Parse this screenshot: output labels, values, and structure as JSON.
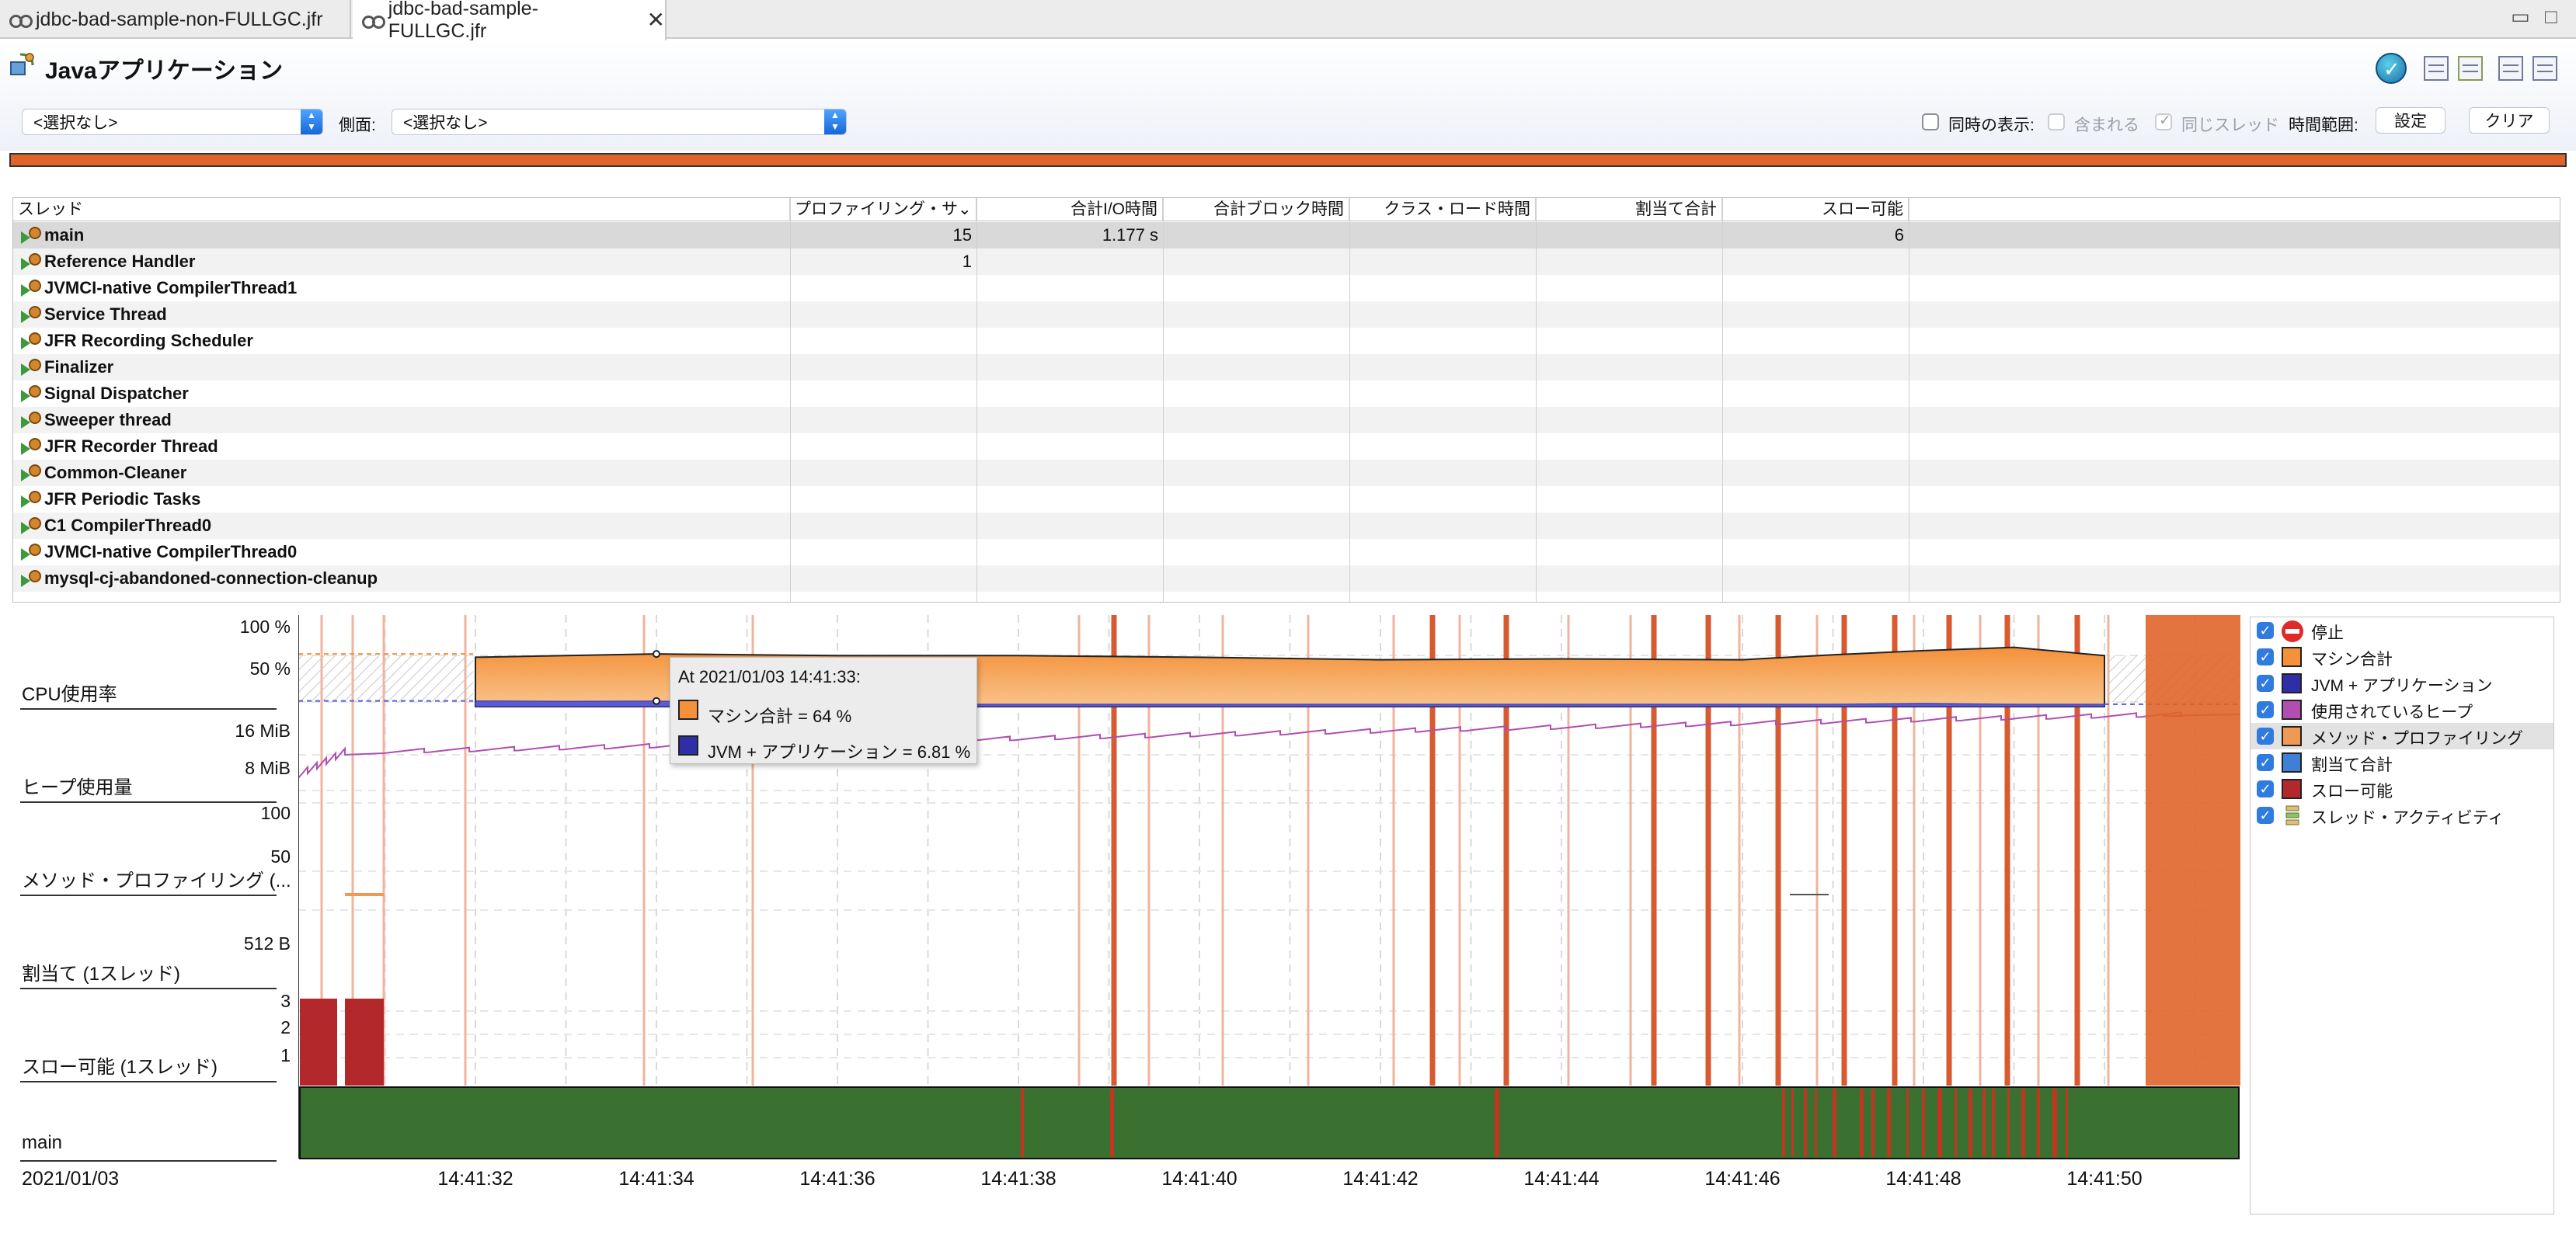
{
  "tabs": [
    {
      "label": "jdbc-bad-sample-non-FULLGC.jfr",
      "active": false
    },
    {
      "label": "jdbc-bad-sample-FULLGC.jfr",
      "active": true
    }
  ],
  "window": {
    "minimize": "▭",
    "maximize": "□"
  },
  "page": {
    "title": "Javaアプリケーション",
    "status_icon": "check-icon"
  },
  "filter": {
    "primary_value": "<選択なし>",
    "aspect_label": "側面:",
    "aspect_value": "<選択なし>",
    "concurrent_label": "同時の表示:",
    "include_label": "含まれる",
    "same_thread_label": "同じスレッド",
    "time_range_label": "時間範囲:",
    "set_button": "設定",
    "clear_button": "クリア"
  },
  "colors": {
    "range_bar": "#e0642a",
    "machine_total": "#f4913a",
    "jvm_app": "#2e2ea6",
    "heap": "#b04fb0",
    "method_profiling": "#ee9a55",
    "allocation": "#3f7fd6",
    "throwables": "#b3282b",
    "thread_running": "#3a7030",
    "thread_blocked": "#c43521"
  },
  "table": {
    "columns": [
      "スレッド",
      "プロファイリング・サ",
      "合計I/O時間",
      "合計ブロック時間",
      "クラス・ロード時間",
      "割当て合計",
      "スロー可能"
    ],
    "sort_indicator": "⌄",
    "rows": [
      {
        "name": "main",
        "profiling": "15",
        "io": "1.177 s",
        "block": "",
        "classload": "",
        "alloc": "",
        "throwables": "6"
      },
      {
        "name": "Reference Handler",
        "profiling": "1",
        "io": "",
        "block": "",
        "classload": "",
        "alloc": "",
        "throwables": ""
      },
      {
        "name": "JVMCI-native CompilerThread1",
        "profiling": "",
        "io": "",
        "block": "",
        "classload": "",
        "alloc": "",
        "throwables": ""
      },
      {
        "name": "Service Thread",
        "profiling": "",
        "io": "",
        "block": "",
        "classload": "",
        "alloc": "",
        "throwables": ""
      },
      {
        "name": "JFR Recording Scheduler",
        "profiling": "",
        "io": "",
        "block": "",
        "classload": "",
        "alloc": "",
        "throwables": ""
      },
      {
        "name": "Finalizer",
        "profiling": "",
        "io": "",
        "block": "",
        "classload": "",
        "alloc": "",
        "throwables": ""
      },
      {
        "name": "Signal Dispatcher",
        "profiling": "",
        "io": "",
        "block": "",
        "classload": "",
        "alloc": "",
        "throwables": ""
      },
      {
        "name": "Sweeper thread",
        "profiling": "",
        "io": "",
        "block": "",
        "classload": "",
        "alloc": "",
        "throwables": ""
      },
      {
        "name": "JFR Recorder Thread",
        "profiling": "",
        "io": "",
        "block": "",
        "classload": "",
        "alloc": "",
        "throwables": ""
      },
      {
        "name": "Common-Cleaner",
        "profiling": "",
        "io": "",
        "block": "",
        "classload": "",
        "alloc": "",
        "throwables": ""
      },
      {
        "name": "JFR Periodic Tasks",
        "profiling": "",
        "io": "",
        "block": "",
        "classload": "",
        "alloc": "",
        "throwables": ""
      },
      {
        "name": "C1 CompilerThread0",
        "profiling": "",
        "io": "",
        "block": "",
        "classload": "",
        "alloc": "",
        "throwables": ""
      },
      {
        "name": "JVMCI-native CompilerThread0",
        "profiling": "",
        "io": "",
        "block": "",
        "classload": "",
        "alloc": "",
        "throwables": ""
      },
      {
        "name": "mysql-cj-abandoned-connection-cleanup",
        "profiling": "",
        "io": "",
        "block": "",
        "classload": "",
        "alloc": "",
        "throwables": ""
      }
    ]
  },
  "lanes": {
    "cpu": {
      "label": "CPU使用率",
      "ticks": [
        "100 %",
        "50 %"
      ]
    },
    "heap": {
      "label": "ヒープ使用量",
      "ticks": [
        "16 MiB",
        "8 MiB"
      ]
    },
    "method": {
      "label": "メソッド・プロファイリング (...",
      "ticks": [
        "100",
        "50"
      ]
    },
    "alloc": {
      "label": "割当て (1スレッド)",
      "ticks": [
        "512 B"
      ]
    },
    "throw": {
      "label": "スロー可能 (1スレッド)",
      "ticks": [
        "3",
        "2",
        "1"
      ]
    },
    "thread": {
      "label": "main"
    }
  },
  "axis": {
    "date": "2021/01/03",
    "ticks": [
      "14:41:32",
      "14:41:34",
      "14:41:36",
      "14:41:38",
      "14:41:40",
      "14:41:42",
      "14:41:44",
      "14:41:46",
      "14:41:48",
      "14:41:50"
    ]
  },
  "tooltip": {
    "title": "At 2021/01/03 14:41:33:",
    "line1": "マシン合計 = 64 %",
    "line2": "JVM + アプリケーション = 6.81 %"
  },
  "legend": [
    {
      "label": "停止",
      "icon": "stop-icon"
    },
    {
      "label": "マシン合計",
      "color": "#f4913a"
    },
    {
      "label": "JVM + アプリケーション",
      "color": "#2e2ea6"
    },
    {
      "label": "使用されているヒープ",
      "color": "#b04fb0"
    },
    {
      "label": "メソッド・プロファイリング",
      "color": "#ee9a55",
      "selected": true
    },
    {
      "label": "割当て合計",
      "color": "#3f7fd6"
    },
    {
      "label": "スロー可能",
      "color": "#b3282b"
    },
    {
      "label": "スレッド・アクティビティ",
      "icon": "thread-activity-icon"
    }
  ],
  "chart_data": {
    "type": "area",
    "x_unit": "time (14:41:xx)",
    "x": [
      "14:41:32",
      "14:41:33",
      "14:41:34",
      "14:41:36",
      "14:41:38",
      "14:41:40",
      "14:41:42",
      "14:41:44",
      "14:41:46",
      "14:41:47",
      "14:41:48",
      "14:41:49",
      "14:41:50"
    ],
    "series": [
      {
        "name": "マシン合計",
        "values": [
          60,
          62,
          64,
          62,
          62,
          60,
          57,
          58,
          57,
          63,
          68,
          72,
          62
        ]
      },
      {
        "name": "JVM + アプリケーション",
        "values": [
          7,
          6.5,
          6.81,
          3,
          3,
          3,
          3,
          3,
          3,
          3,
          4,
          3,
          3
        ]
      }
    ],
    "ylim": [
      0,
      100
    ]
  }
}
